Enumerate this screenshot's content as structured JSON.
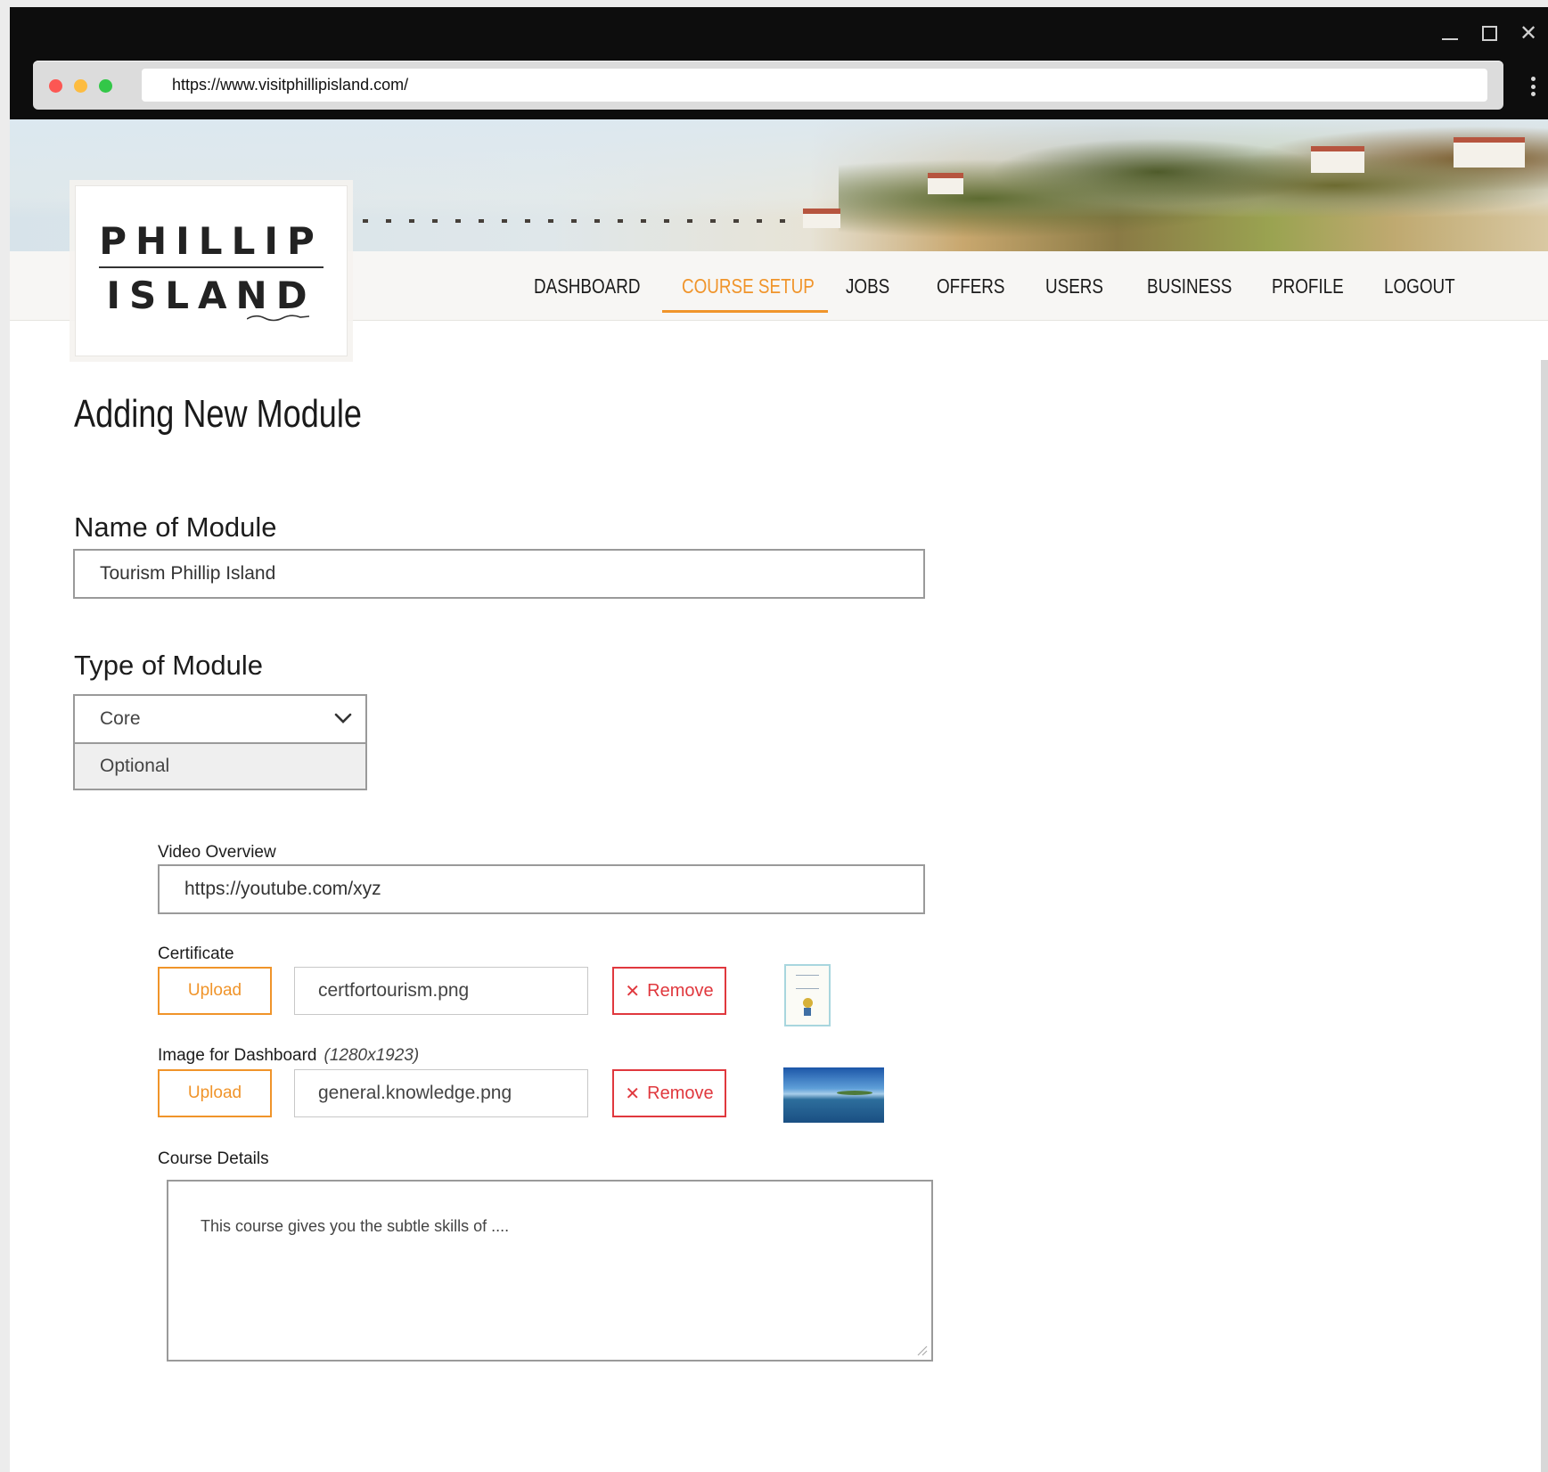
{
  "browser": {
    "url": "https://www.visitphillipisland.com/",
    "window_controls": [
      "minimize-icon",
      "maximize-icon",
      "close-icon"
    ],
    "menu_icon": "kebab-menu-icon"
  },
  "logo": {
    "line1": "PHILLIP",
    "line2": "ISLAND"
  },
  "nav": {
    "items": [
      {
        "label": "DASHBOARD"
      },
      {
        "label": "COURSE SETUP"
      },
      {
        "label": "JOBS"
      },
      {
        "label": "OFFERS"
      },
      {
        "label": "USERS"
      },
      {
        "label": "BUSINESS"
      },
      {
        "label": "PROFILE"
      },
      {
        "label": "LOGOUT"
      }
    ],
    "active": "COURSE SETUP"
  },
  "page": {
    "title": "Adding New Module"
  },
  "form": {
    "name_label": "Name of Module",
    "name_value": "Tourism Phillip Island",
    "type_label": "Type of Module",
    "type_options": [
      "Core",
      "Optional"
    ],
    "type_selected": "Core",
    "video_label": "Video Overview",
    "video_value": "https://youtube.com/xyz",
    "certificate_label": "Certificate",
    "certificate_file": "certfortourism.png",
    "dashboard_image_label": "Image for Dashboard",
    "dashboard_image_size": "(1280x1923)",
    "dashboard_image_file": "general.knowledge.png",
    "upload_label": "Upload",
    "remove_label": "Remove",
    "course_details_label": "Course Details",
    "course_details_value": "This course gives you the subtle skills of ...."
  },
  "colors": {
    "accent": "#f0942a",
    "danger": "#e0383e",
    "titlebar": "#0d0d0d"
  }
}
